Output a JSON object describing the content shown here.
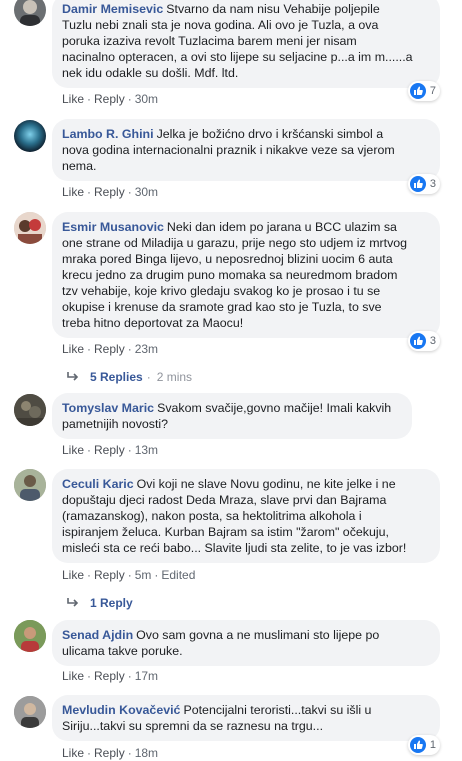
{
  "actions": {
    "like": "Like",
    "reply": "Reply",
    "dot": "·"
  },
  "comments": [
    {
      "author": "Damir Memisevic",
      "text": "Stvarno da nam nisu Vehabije poljepile\nTuzlu nebi znali sta je nova godina. Ali ovo je Tuzla, a ova\nporuka izaziva revolt Tuzlacima barem meni jer nisam\nnacinalno opteracen, a ovi sto lijepe su seljacine p...a im m......a\nnek idu odakle su došli. Mdf. ltd.",
      "time": "30m",
      "reactions": "7"
    },
    {
      "author": "Lambo R. Ghini",
      "text": "Jelka je božićno drvo i kršćanski simbol a\nnova godina internacionalni praznik i nikakve veze sa vjerom\nnema.",
      "time": "30m",
      "reactions": "3"
    },
    {
      "author": "Esmir Musanovic",
      "text": "Neki dan idem po jarana u BCC ulazim sa\none strane od Miladija u garazu, prije nego sto udjem iz mrtvog\nmraka pored Binga lijevo, u neposrednoj blizini uocim 6 auta\nkrecu jedno za drugim puno momaka sa neuredmom bradom\ntzv vehabije, koje krivo gledaju svakog ko je prosao i tu se\nokupise i krenuse da sramote grad kao sto je Tuzla, to sve\ntreba hitno deportovat za Maocu!",
      "time": "23m",
      "reactions": "3",
      "replies": "5 Replies",
      "replies_time": "2 mins"
    },
    {
      "author": "Tomyslav Maric",
      "text": "Svakom svačije,govno mačije! Imali kakvih\npametnijih novosti?",
      "time": "13m"
    },
    {
      "author": "Ceculi Karic",
      "text": "Ovi koji ne slave Novu godinu, ne kite jelke i ne\ndopuštaju djeci radost Deda Mraza, slave prvi dan Bajrama\n(ramazanskog), nakon posta, sa hektolitrima alkohola i\nispiranjem želuca. Kurban Bajram sa istim \"žarom\" očekuju,\nmisleći sta ce reći babo... Slavite ljudi sta zelite, to je vas izbor!",
      "time": "5m",
      "edited": "Edited",
      "replies": "1 Reply"
    },
    {
      "author": "Senad Ajdin",
      "text": "Ovo sam govna a ne muslimani sto lijepe po\nulicama takve poruke.",
      "time": "17m"
    },
    {
      "author": "Mevludin Kovačević",
      "text": "Potencijalni teroristi...takvi su išli u\nSiriju...takvi su spremni da se raznesu na trgu...",
      "time": "18m",
      "reactions": "1"
    }
  ]
}
